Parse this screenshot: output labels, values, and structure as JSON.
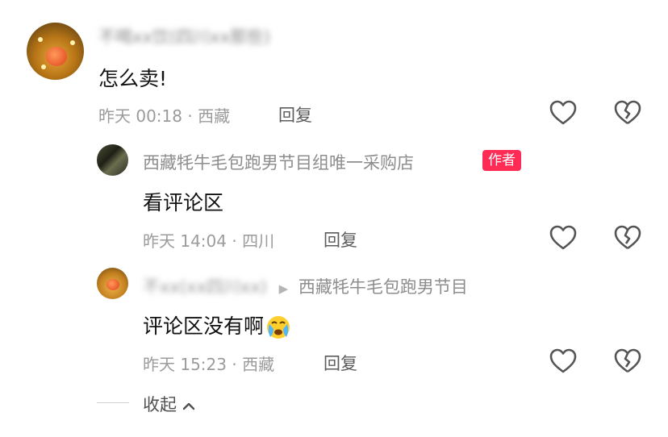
{
  "comment": {
    "username": "不喝xx饮(四川xx那些)",
    "text": "怎么卖!",
    "time": "昨天 00:18",
    "location": "西藏",
    "reply_label": "回复"
  },
  "replies": [
    {
      "username": "西藏牦牛毛包跑男节目组唯一采购店",
      "badge": "作者",
      "text": "看评论区",
      "time": "昨天 14:04",
      "location": "四川",
      "reply_label": "回复"
    },
    {
      "username": "不xx(xx四川xx)",
      "reply_to": "西藏牦牛毛包跑男节目",
      "text": "评论区没有啊",
      "emoji": "crying-face-emoji",
      "time": "昨天 15:23",
      "location": "西藏",
      "reply_label": "回复"
    }
  ],
  "collapse_label": "收起",
  "icons": {
    "like": "heart-icon",
    "dislike": "broken-heart-icon",
    "collapse": "chevron-up-icon"
  },
  "colors": {
    "author_badge": "#fe2c55"
  }
}
